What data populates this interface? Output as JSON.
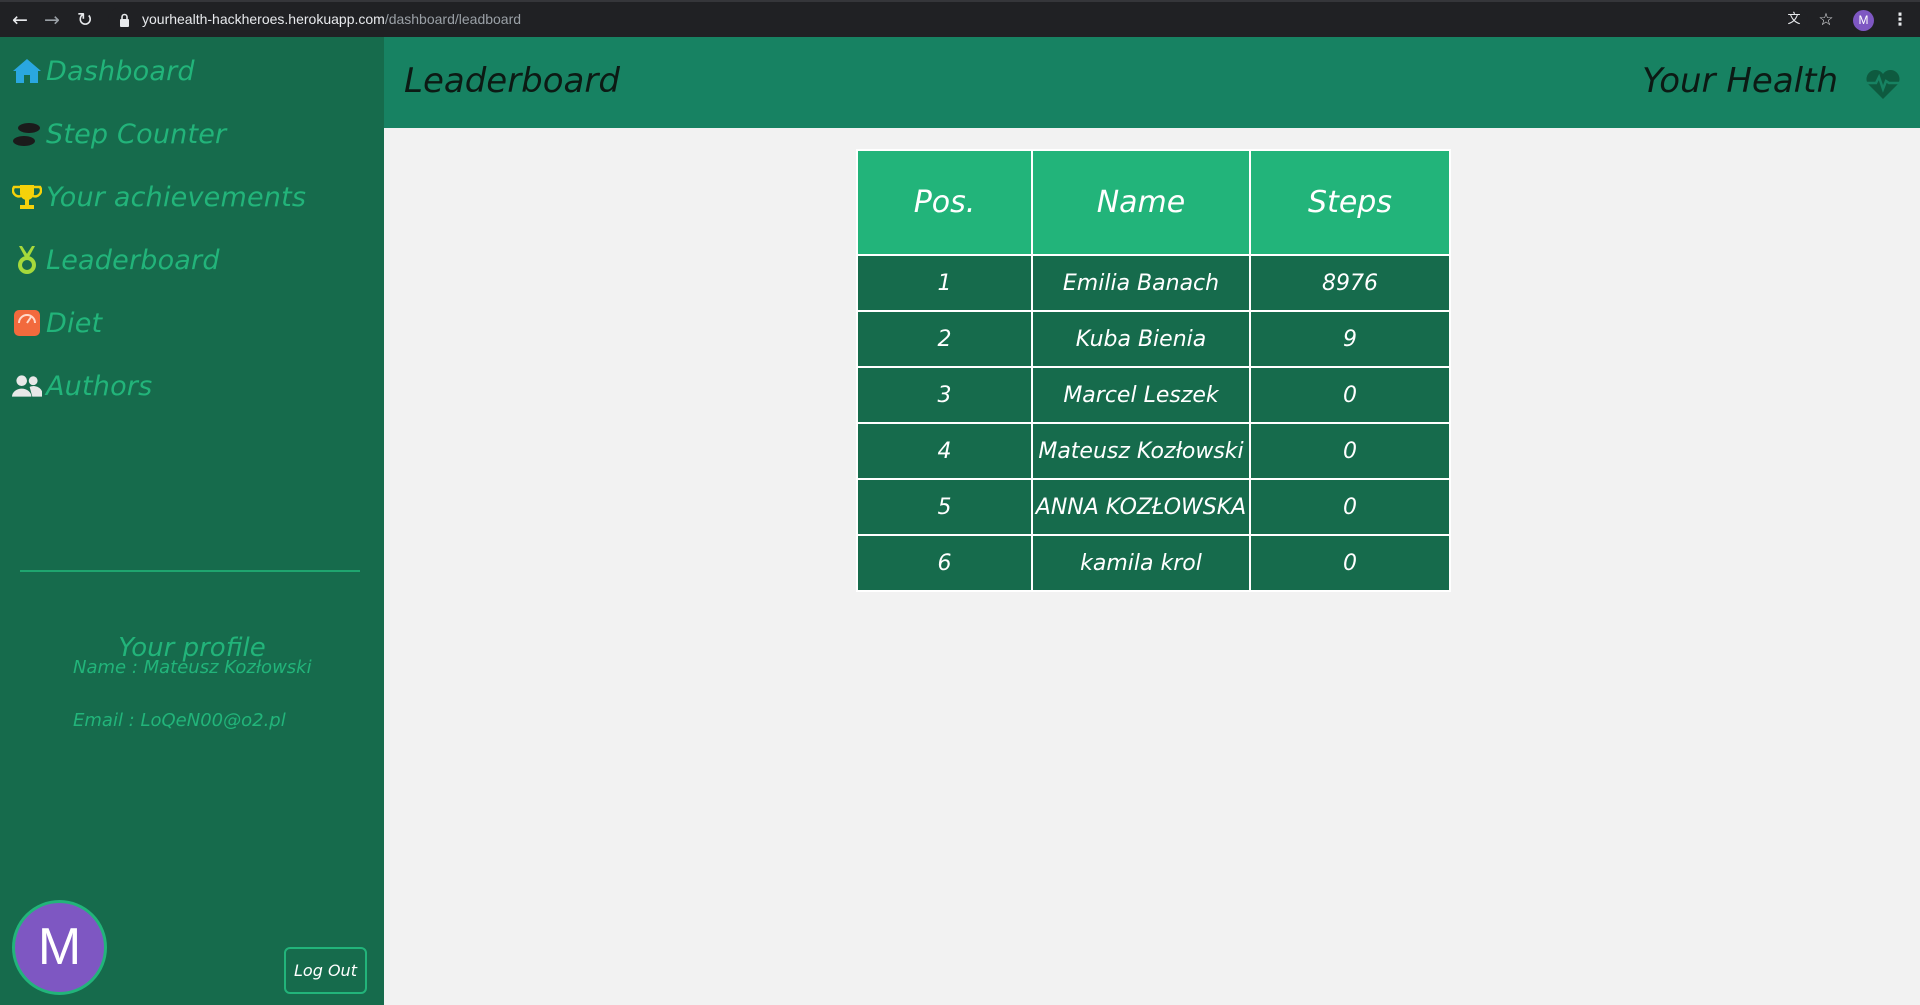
{
  "browser": {
    "url_host": "yourhealth-hackheroes.herokuapp.com",
    "url_path": "/dashboard/leadboard",
    "profile_initial": "M"
  },
  "sidebar": {
    "items": [
      {
        "label": "Dashboard",
        "icon": "home-icon",
        "color": "#2aa7e0"
      },
      {
        "label": "Step Counter",
        "icon": "footprints-icon",
        "color": "#1b1b1b"
      },
      {
        "label": "Your achievements",
        "icon": "trophy-icon",
        "color": "#f5d20a"
      },
      {
        "label": "Leaderboard",
        "icon": "medal-icon",
        "color": "#a6d93b"
      },
      {
        "label": "Diet",
        "icon": "scale-icon",
        "color": "#f26a3d"
      },
      {
        "label": "Authors",
        "icon": "users-icon",
        "color": "#e8e8e8"
      }
    ],
    "profile": {
      "title": "Your profile",
      "name_line": "Name : Mateusz Kozłowski",
      "email_line": "Email : LoQeN00@o2.pl"
    },
    "avatar_initial": "M",
    "logout_label": "Log Out"
  },
  "header": {
    "title": "Leaderboard",
    "brand": "Your Health",
    "brand_icon": "heart-pulse-icon"
  },
  "leaderboard": {
    "columns": [
      "Pos.",
      "Name",
      "Steps"
    ],
    "rows": [
      {
        "pos": "1",
        "name": "Emilia Banach",
        "steps": "8976"
      },
      {
        "pos": "2",
        "name": "Kuba Bienia",
        "steps": "9"
      },
      {
        "pos": "3",
        "name": "Marcel Leszek",
        "steps": "0"
      },
      {
        "pos": "4",
        "name": "Mateusz Kozłowski",
        "steps": "0"
      },
      {
        "pos": "5",
        "name": "ANNA KOZŁOWSKA",
        "steps": "0"
      },
      {
        "pos": "6",
        "name": "kamila krol",
        "steps": "0"
      }
    ]
  },
  "colors": {
    "sidebar_bg": "#166b4c",
    "header_bg": "#178262",
    "accent": "#22b47a",
    "avatar": "#7e57c2"
  }
}
